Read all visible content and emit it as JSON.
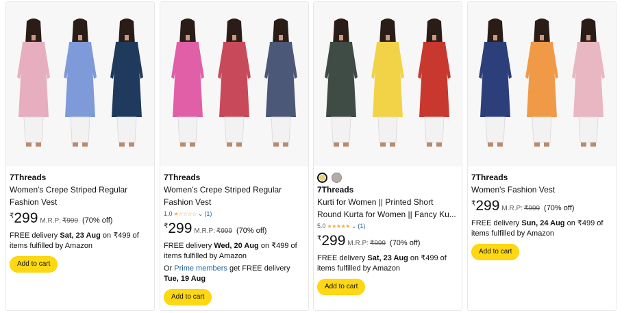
{
  "colors": {
    "atc_yellow": "#ffd814",
    "link_blue": "#2162a1",
    "star_orange": "#f3a847"
  },
  "products": [
    {
      "brand": "7Threads",
      "title": "Women's Crepe Striped Regular Fashion Vest",
      "rating_value": "",
      "rating_count": "",
      "currency": "₹",
      "price": "299",
      "mrp_label": "M.R.P:",
      "mrp": "₹999",
      "discount": "(70% off)",
      "delivery_prefix": "FREE delivery ",
      "delivery_date": "Sat, 23 Aug",
      "delivery_suffix": " on ₹499 of items fulfilled by Amazon",
      "button": "Add to cart",
      "figures": [
        "#e7aec0",
        "#7f9ad8",
        "#1f3a5c"
      ]
    },
    {
      "brand": "7Threads",
      "title": "Women's Crepe Striped Regular Fashion Vest",
      "rating_value": "1.0",
      "rating_stars": "★☆☆☆☆",
      "rating_count": "(1)",
      "currency": "₹",
      "price": "299",
      "mrp_label": "M.R.P:",
      "mrp": "₹999",
      "discount": "(70% off)",
      "delivery_prefix": "FREE delivery ",
      "delivery_date": "Wed, 20 Aug",
      "delivery_suffix": " on ₹499 of items fulfilled by Amazon",
      "prime_prefix": "Or ",
      "prime_link": "Prime members",
      "prime_mid": " get FREE delivery ",
      "prime_date": "Tue, 19 Aug",
      "button": "Add to cart",
      "figures": [
        "#e15fa7",
        "#c84a5a",
        "#4b5878"
      ]
    },
    {
      "brand": "7Threads",
      "title": "Kurti for Women || Printed Short Round Kurta for Women || Fancy Ku...",
      "swatch_colors": [
        "#e9d37a",
        "#b8aaa8"
      ],
      "rating_value": "5.0",
      "rating_stars": "★★★★★",
      "rating_count": "(1)",
      "currency": "₹",
      "price": "299",
      "mrp_label": "M.R.P:",
      "mrp": "₹999",
      "discount": "(70% off)",
      "delivery_prefix": "FREE delivery ",
      "delivery_date": "Sat, 23 Aug",
      "delivery_suffix": " on ₹499 of items fulfilled by Amazon",
      "button": "Add to cart",
      "figures": [
        "#3f4b45",
        "#f2d348",
        "#c8382f"
      ]
    },
    {
      "brand": "7Threads",
      "title": "Women's Fashion Vest",
      "rating_value": "",
      "rating_count": "",
      "currency": "₹",
      "price": "299",
      "mrp_label": "M.R.P:",
      "mrp": "₹999",
      "discount": "(70% off)",
      "delivery_prefix": "FREE delivery ",
      "delivery_date": "Sun, 24 Aug",
      "delivery_suffix": " on ₹499 of items fulfilled by Amazon",
      "button": "Add to cart",
      "figures": [
        "#2d3f7a",
        "#f09a48",
        "#e9b7c1"
      ]
    }
  ]
}
